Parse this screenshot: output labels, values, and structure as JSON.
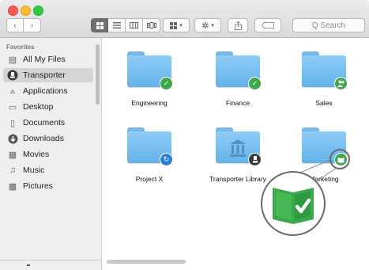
{
  "sidebar": {
    "header": "Favorites",
    "items": [
      {
        "label": "All My Files",
        "icon": "all-files-icon",
        "glyph": "▤"
      },
      {
        "label": "Transporter",
        "icon": "transporter-icon",
        "glyph": "●"
      },
      {
        "label": "Applications",
        "icon": "applications-icon",
        "glyph": "⟑"
      },
      {
        "label": "Desktop",
        "icon": "desktop-icon",
        "glyph": "▭"
      },
      {
        "label": "Documents",
        "icon": "documents-icon",
        "glyph": "▯"
      },
      {
        "label": "Downloads",
        "icon": "downloads-icon",
        "glyph": "⬇"
      },
      {
        "label": "Movies",
        "icon": "movies-icon",
        "glyph": "▦"
      },
      {
        "label": "Music",
        "icon": "music-icon",
        "glyph": "♫"
      },
      {
        "label": "Pictures",
        "icon": "pictures-icon",
        "glyph": "▩"
      }
    ],
    "selected_index": 1
  },
  "toolbar": {
    "back_glyph": "‹",
    "forward_glyph": "›",
    "search_placeholder": "Q Search"
  },
  "folders": [
    {
      "name": "Engineering",
      "badge": "check",
      "badge_color": "#3aa84b"
    },
    {
      "name": "Finance",
      "badge": "check",
      "badge_color": "#3aa84b"
    },
    {
      "name": "Sales",
      "badge": "people",
      "badge_color": "#3aa84b"
    },
    {
      "name": "Project X",
      "badge": "sync",
      "badge_color": "#2d7fd3"
    },
    {
      "name": "Transporter Library",
      "badge": "transporter",
      "badge_color": "#3b3b3b"
    },
    {
      "name": "Marketing",
      "badge": "book-check",
      "badge_color": "#3aa84b"
    }
  ],
  "colors": {
    "folder": "#7cc1f2",
    "accent_green": "#3aa84b",
    "sync_blue": "#2d7fd3"
  }
}
